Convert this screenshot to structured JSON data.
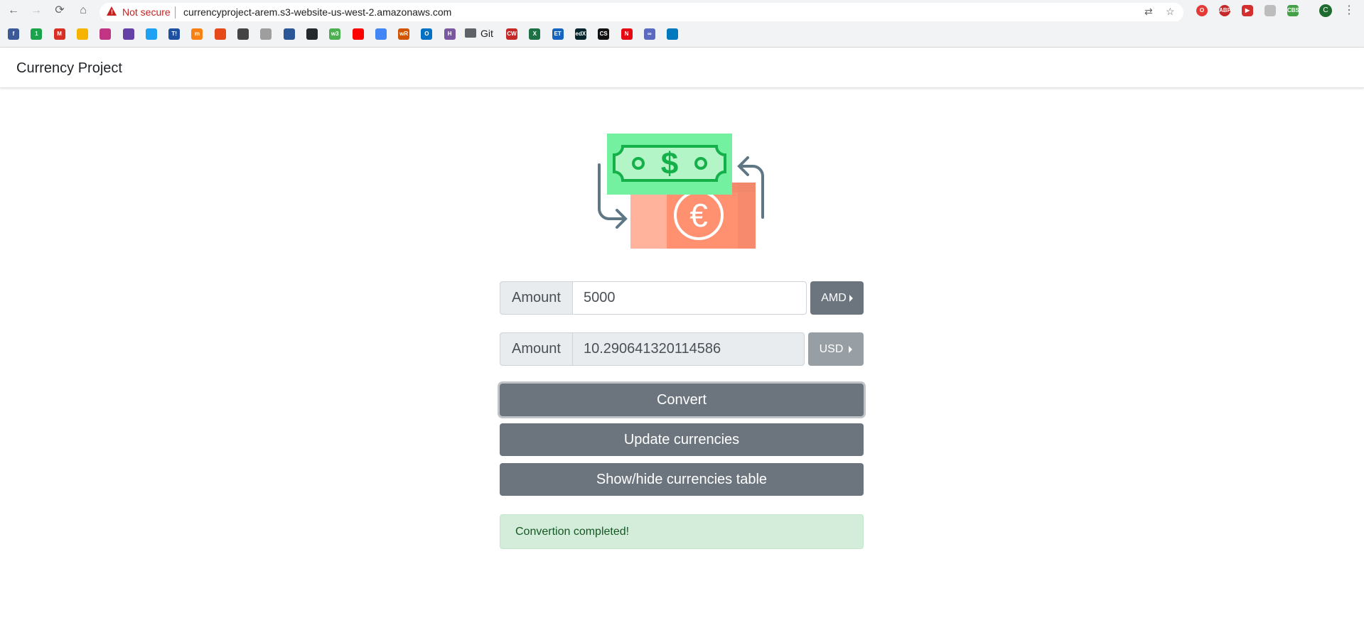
{
  "browser": {
    "security_label": "Not secure",
    "url": "currencyproject-arem.s3-website-us-west-2.amazonaws.com",
    "profile_initial": "C",
    "bookmark_folder_label": "Git",
    "bookmarks": [
      {
        "icon": "facebook-icon",
        "color": "#3b5998",
        "text": "f"
      },
      {
        "icon": "onepassword-icon",
        "color": "#1aa34a",
        "text": "1"
      },
      {
        "icon": "gmail-icon",
        "color": "#d93025",
        "text": "M"
      },
      {
        "icon": "drive-icon",
        "color": "#f4b400",
        "text": ""
      },
      {
        "icon": "instagram-icon",
        "color": "#c13584",
        "text": ""
      },
      {
        "icon": "twitch-icon",
        "color": "#6441a5",
        "text": ""
      },
      {
        "icon": "twitter-icon",
        "color": "#1da1f2",
        "text": ""
      },
      {
        "icon": "trello-t-icon",
        "color": "#1f4fa0",
        "text": "T!"
      },
      {
        "icon": "moodle-icon",
        "color": "#f98012",
        "text": "m"
      },
      {
        "icon": "office-icon",
        "color": "#e64a19",
        "text": ""
      },
      {
        "icon": "chart-icon",
        "color": "#444444",
        "text": ""
      },
      {
        "icon": "paper-icon",
        "color": "#9e9e9e",
        "text": ""
      },
      {
        "icon": "globe-icon",
        "color": "#2b5797",
        "text": ""
      },
      {
        "icon": "github-icon",
        "color": "#24292e",
        "text": ""
      },
      {
        "icon": "w3-icon",
        "color": "#4caf50",
        "text": "w3"
      },
      {
        "icon": "youtube-icon",
        "color": "#ff0000",
        "text": ""
      },
      {
        "icon": "translate-icon",
        "color": "#4285f4",
        "text": ""
      },
      {
        "icon": "wordreference-icon",
        "color": "#d35400",
        "text": "wR"
      },
      {
        "icon": "outlook-icon",
        "color": "#0072c6",
        "text": "O"
      },
      {
        "icon": "heroku-icon",
        "color": "#79589f",
        "text": "H"
      }
    ],
    "bookmarks_after": [
      {
        "icon": "cw-icon",
        "color": "#c62828",
        "text": "CW"
      },
      {
        "icon": "excel-icon",
        "color": "#1e7145",
        "text": "X"
      },
      {
        "icon": "et-icon",
        "color": "#1565c0",
        "text": "ET"
      },
      {
        "icon": "edx-icon",
        "color": "#02262b",
        "text": "edX"
      },
      {
        "icon": "cs-icon",
        "color": "#111111",
        "text": "CS"
      },
      {
        "icon": "netflix-icon",
        "color": "#e50914",
        "text": "N"
      },
      {
        "icon": "link-icon",
        "color": "#5c6bc0",
        "text": "∞"
      },
      {
        "icon": "trello-icon",
        "color": "#0079bf",
        "text": ""
      }
    ]
  },
  "navbar": {
    "brand": "Currency Project"
  },
  "form": {
    "from": {
      "prepend": "Amount",
      "value": "5000",
      "currency": "AMD"
    },
    "to": {
      "prepend": "Amount",
      "value": "10.290641320114586",
      "currency": "USD"
    }
  },
  "buttons": {
    "convert": "Convert",
    "update": "Update currencies",
    "toggle_table": "Show/hide currencies table"
  },
  "alert": {
    "message": "Convertion completed!"
  },
  "colors": {
    "secondary": "#6c757d",
    "disabled": "#979ea4",
    "success_bg": "#d4edda",
    "success_text": "#155724",
    "bill_green": "#73f0a0",
    "bill_salmon": "#ff9f82"
  }
}
